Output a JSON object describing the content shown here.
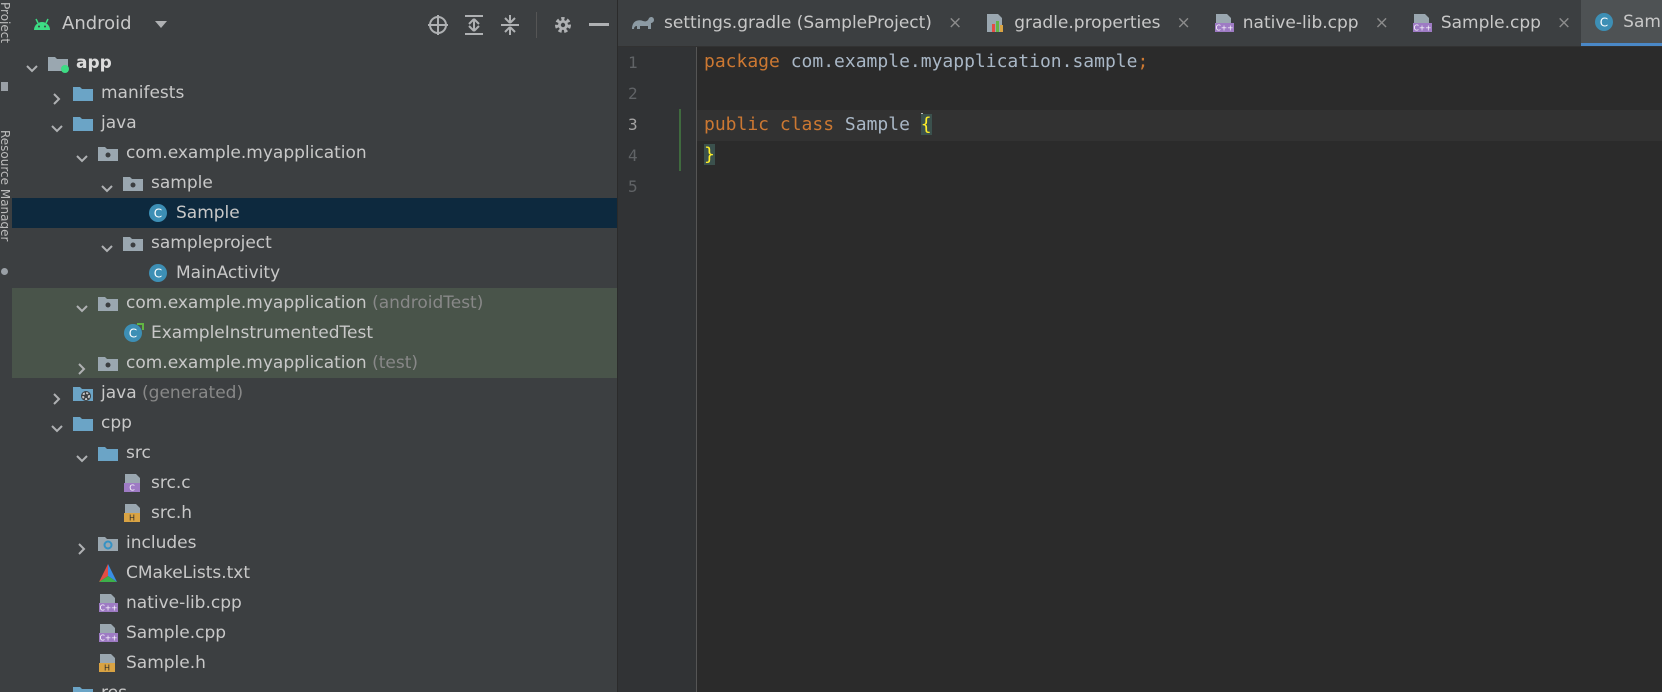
{
  "side_strip": {
    "project_label": "Project",
    "resource_manager_label": "Resource Manager"
  },
  "project_panel": {
    "view_selector": "Android"
  },
  "tree": [
    {
      "label": "app",
      "suffix": "",
      "depth": 0,
      "expanded": true,
      "icon": "module-folder-icon"
    },
    {
      "label": "manifests",
      "suffix": "",
      "depth": 1,
      "expanded": false,
      "icon": "folder-icon"
    },
    {
      "label": "java",
      "suffix": "",
      "depth": 1,
      "expanded": true,
      "icon": "folder-icon"
    },
    {
      "label": "com.example.myapplication",
      "suffix": "",
      "depth": 2,
      "expanded": true,
      "icon": "package-icon"
    },
    {
      "label": "sample",
      "suffix": "",
      "depth": 3,
      "expanded": true,
      "icon": "package-icon"
    },
    {
      "label": "Sample",
      "suffix": "",
      "depth": 4,
      "expanded": null,
      "icon": "java-class-icon",
      "selected": true
    },
    {
      "label": "sampleproject",
      "suffix": "",
      "depth": 3,
      "expanded": true,
      "icon": "package-icon"
    },
    {
      "label": "MainActivity",
      "suffix": "",
      "depth": 4,
      "expanded": null,
      "icon": "java-class-icon"
    },
    {
      "label": "com.example.myapplication",
      "suffix": "(androidTest)",
      "depth": 2,
      "expanded": true,
      "icon": "package-icon",
      "test": true
    },
    {
      "label": "ExampleInstrumentedTest",
      "suffix": "",
      "depth": 3,
      "expanded": null,
      "icon": "test-class-icon",
      "test": true
    },
    {
      "label": "com.example.myapplication",
      "suffix": "(test)",
      "depth": 2,
      "expanded": false,
      "icon": "package-icon",
      "test": true
    },
    {
      "label": "java",
      "suffix": "(generated)",
      "depth": 1,
      "expanded": false,
      "icon": "generated-folder-icon"
    },
    {
      "label": "cpp",
      "suffix": "",
      "depth": 1,
      "expanded": true,
      "icon": "folder-icon"
    },
    {
      "label": "src",
      "suffix": "",
      "depth": 2,
      "expanded": true,
      "icon": "folder-icon"
    },
    {
      "label": "src.c",
      "suffix": "",
      "depth": 3,
      "expanded": null,
      "icon": "c-file-icon"
    },
    {
      "label": "src.h",
      "suffix": "",
      "depth": 3,
      "expanded": null,
      "icon": "h-file-icon"
    },
    {
      "label": "includes",
      "suffix": "",
      "depth": 2,
      "expanded": false,
      "icon": "includes-folder-icon"
    },
    {
      "label": "CMakeLists.txt",
      "suffix": "",
      "depth": 2,
      "expanded": null,
      "icon": "cmake-icon"
    },
    {
      "label": "native-lib.cpp",
      "suffix": "",
      "depth": 2,
      "expanded": null,
      "icon": "cpp-file-icon"
    },
    {
      "label": "Sample.cpp",
      "suffix": "",
      "depth": 2,
      "expanded": null,
      "icon": "cpp-file-icon"
    },
    {
      "label": "Sample.h",
      "suffix": "",
      "depth": 2,
      "expanded": null,
      "icon": "h-file-icon"
    },
    {
      "label": "res",
      "suffix": "",
      "depth": 1,
      "expanded": true,
      "icon": "folder-icon"
    }
  ],
  "tabs": [
    {
      "label": "settings.gradle (SampleProject)",
      "icon": "gradle-icon",
      "active": false
    },
    {
      "label": "gradle.properties",
      "icon": "properties-icon",
      "active": false
    },
    {
      "label": "native-lib.cpp",
      "icon": "cpp-file-icon",
      "active": false
    },
    {
      "label": "Sample.cpp",
      "icon": "cpp-file-icon",
      "active": false
    },
    {
      "label": "Sample.java",
      "icon": "java-class-icon",
      "active": true
    }
  ],
  "editor": {
    "line_numbers": [
      "1",
      "2",
      "3",
      "4",
      "5"
    ],
    "current_line": "3",
    "lines": {
      "l1": {
        "kw": "package",
        "rest": " com.example.myapplication.sample",
        "semi": ";"
      },
      "l3": {
        "kw1": "public",
        "kw2": "class",
        "name": " Sample ",
        "brace": "{"
      },
      "l4": {
        "brace": "}"
      }
    }
  },
  "colors": {
    "keyword": "#cc7832",
    "text": "#a9b7c6",
    "selection": "#0d293e",
    "test_bg": "#49544a",
    "accent": "#4a88c7"
  }
}
